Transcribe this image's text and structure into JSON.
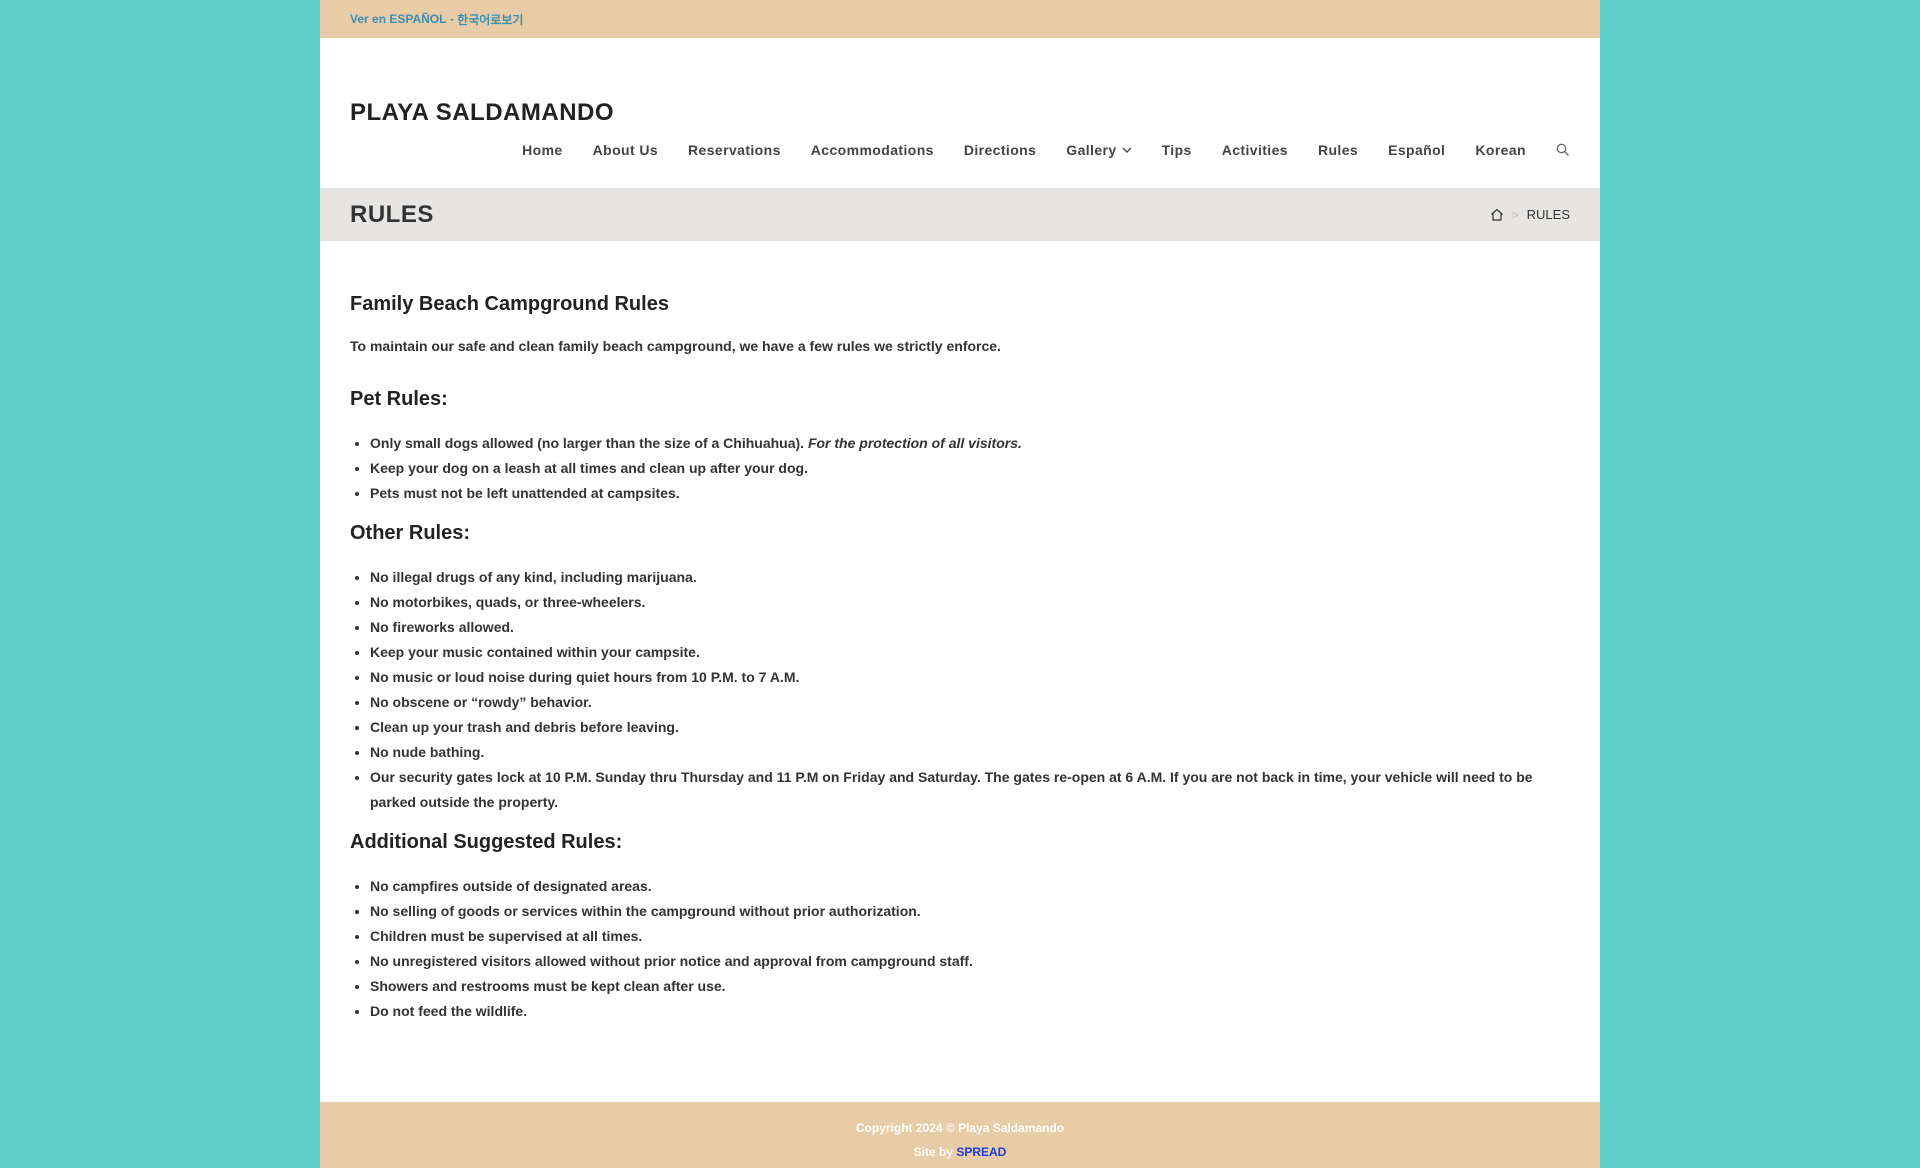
{
  "topbar": {
    "spanish_link": "Ver en ESPAÑOL",
    "separator": " - ",
    "korean_link": "한국어로보기"
  },
  "header": {
    "logo": "PLAYA SALDAMANDO",
    "nav": [
      "Home",
      "About Us",
      "Reservations",
      "Accommodations",
      "Directions",
      "Gallery",
      "Tips",
      "Activities",
      "Rules",
      "Español",
      "Korean"
    ]
  },
  "titlebar": {
    "title": "RULES",
    "breadcrumb_current": "RULES",
    "breadcrumb_sep": ">"
  },
  "content": {
    "heading": "Family Beach Campground Rules",
    "intro": "To maintain our safe and clean family beach campground, we have a few rules we strictly enforce.",
    "pet_heading": "Pet Rules:",
    "pet_rules": [
      "Only small dogs allowed (no larger than the size of a Chihuahua). ",
      "Keep your dog on a leash at all times and clean up after your dog.",
      "Pets must not be left unattended at campsites."
    ],
    "pet_rule_emphasis": "For the protection of all visitors.",
    "other_heading": "Other Rules:",
    "other_rules": [
      "No illegal drugs of any kind, including marijuana.",
      "No motorbikes, quads, or three-wheelers.",
      "No fireworks allowed.",
      "Keep your music contained within your campsite.",
      "No music or loud noise during quiet hours from 10 P.M. to 7 A.M.",
      "No obscene or “rowdy” behavior.",
      "Clean up your trash and debris before leaving.",
      "No nude bathing.",
      "Our security gates lock at 10 P.M. Sunday thru Thursday and 11 P.M on Friday and Saturday. The gates re-open at 6 A.M. If you are not back in time, your vehicle will need to be parked outside the property."
    ],
    "additional_heading": "Additional Suggested Rules:",
    "additional_rules": [
      "No campfires outside of designated areas.",
      "No selling of goods or services within the campground without prior authorization.",
      "Children must be supervised at all times.",
      "No unregistered visitors allowed without prior notice and approval from campground staff.",
      "Showers and restrooms must be kept clean after use.",
      "Do not feed the wildlife."
    ]
  },
  "footer": {
    "copyright": "Copyright 2024 © Playa Saldamando",
    "site_by": "Site by ",
    "site_by_link": "SPREAD"
  },
  "colors": {
    "page_bg": "#5fcfc9",
    "topbar_bg": "#e8cba7",
    "titlebar_bg": "#e6e5e3",
    "link_blue": "#3b8fb0",
    "footer_link": "#1a3fd4"
  }
}
